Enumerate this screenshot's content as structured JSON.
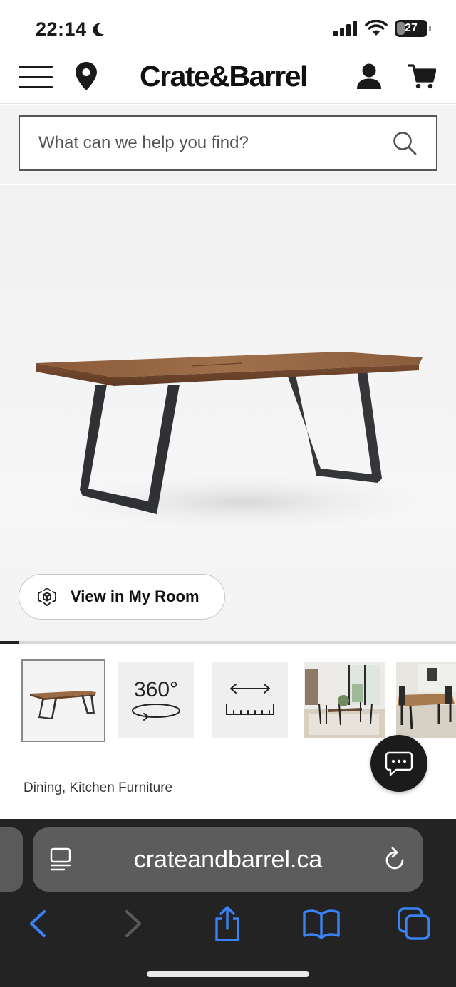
{
  "status_bar": {
    "time": "22:14",
    "battery_level": "27",
    "icons": [
      "moon-icon",
      "signal-icon",
      "wifi-icon",
      "battery-icon"
    ]
  },
  "header": {
    "logo": "Crate&Barrel",
    "icons": [
      "hamburger-menu-icon",
      "location-pin-icon",
      "account-icon",
      "cart-icon"
    ]
  },
  "search": {
    "placeholder": "What can we help you find?",
    "icon": "search-icon"
  },
  "product": {
    "image": "wooden-dining-table-image",
    "view_in_room_label": "View in My Room",
    "carousel_progress": 0.04
  },
  "thumbnails": {
    "items": [
      {
        "type": "product-photo"
      },
      {
        "type": "360-view",
        "label": "360°"
      },
      {
        "type": "dimensions"
      },
      {
        "type": "room-photo"
      },
      {
        "type": "room-photo"
      }
    ]
  },
  "chat": {
    "icon": "chat-bubble-icon"
  },
  "breadcrumb": {
    "text": "Dining, Kitchen Furniture"
  },
  "browser": {
    "url": "crateandbarrel.ca",
    "accent_color": "#3b82f6",
    "toolbar_icons": [
      "back-icon",
      "forward-icon",
      "share-icon",
      "bookmarks-icon",
      "tabs-icon"
    ]
  }
}
